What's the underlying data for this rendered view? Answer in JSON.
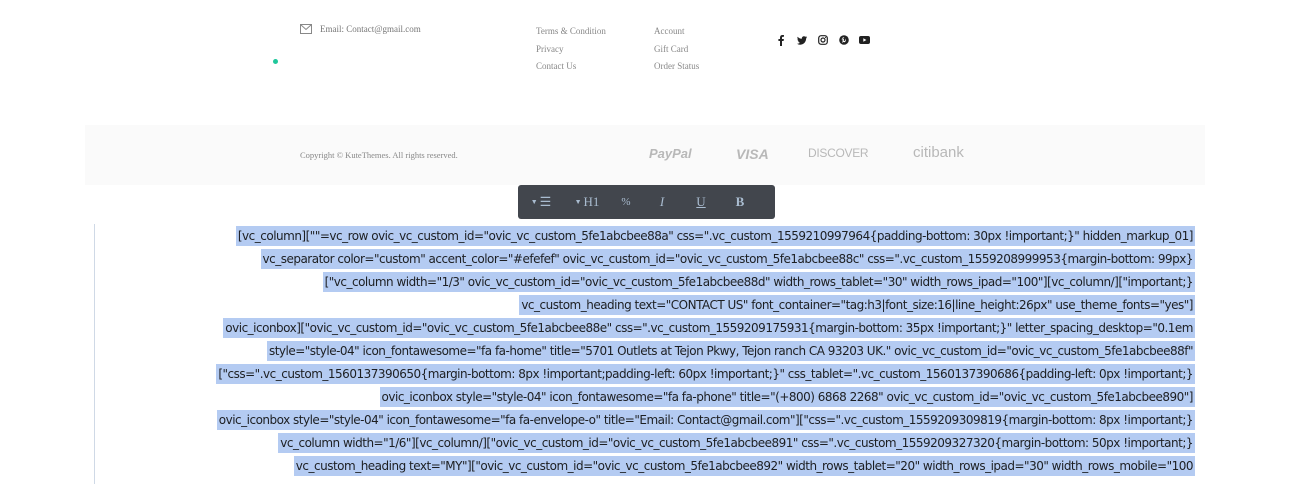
{
  "footer": {
    "email_text": "Email: Contact@gmail.com",
    "links_col1": [
      "Terms & Condition",
      "Privacy",
      "Contact Us"
    ],
    "links_col2": [
      "Account",
      "Gift Card",
      "Order Status"
    ],
    "social_icons": [
      "facebook-icon",
      "twitter-icon",
      "instagram-icon",
      "pinterest-icon",
      "youtube-icon"
    ],
    "accent_color": "#1fc79b"
  },
  "bottom_bar": {
    "copyright": "Copyright © KuteThemes. All rights reserved.",
    "payments": [
      "PayPal",
      "VISA",
      "DISCOVER",
      "citibank"
    ]
  },
  "toolbar": {
    "list_label": "☰",
    "heading_label": "H1",
    "link_label": "%",
    "italic_label": "I",
    "underline_label": "U",
    "bold_label": "B"
  },
  "editor": {
    "lines": [
      "[vc_column][\"\"=vc_row ovic_vc_custom_id=\"ovic_vc_custom_5fe1abcbee88a\" css=\".vc_custom_1559210997964{padding-bottom: 30px !important;}\" hidden_markup_01]",
      "vc_separator color=\"custom\" accent_color=\"#efefef\" ovic_vc_custom_id=\"ovic_vc_custom_5fe1abcbee88c\" css=\".vc_custom_1559208999953{margin-bottom: 99px}",
      "[\"vc_column width=\"1/3\" ovic_vc_custom_id=\"ovic_vc_custom_5fe1abcbee88d\" width_rows_tablet=\"30\" width_rows_ipad=\"100\"][vc_column/][\"important;}",
      "vc_custom_heading text=\"CONTACT US\" font_container=\"tag:h3|font_size:16|line_height:26px\" use_theme_fonts=\"yes\"]",
      "ovic_iconbox][\"ovic_vc_custom_id=\"ovic_vc_custom_5fe1abcbee88e\" css=\".vc_custom_1559209175931{margin-bottom: 35px !important;}\" letter_spacing_desktop=\"0.1em",
      "style=\"style-04\" icon_fontawesome=\"fa fa-home\" title=\"5701 Outlets at Tejon Pkwy, Tejon ranch CA 93203 UK.\" ovic_vc_custom_id=\"ovic_vc_custom_5fe1abcbee88f\"",
      "[\"css=\".vc_custom_1560137390650{margin-bottom: 8px !important;padding-left: 60px !important;}\" css_tablet=\".vc_custom_1560137390686{padding-left: 0px !important;}",
      "ovic_iconbox style=\"style-04\" icon_fontawesome=\"fa fa-phone\" title=\"(+800) 6868 2268\" ovic_vc_custom_id=\"ovic_vc_custom_5fe1abcbee890\"]",
      "ovic_iconbox style=\"style-04\" icon_fontawesome=\"fa fa-envelope-o\" title=\"Email: Contact@gmail.com\"][\"css=\".vc_custom_1559209309819{margin-bottom: 8px !important;}",
      "vc_column width=\"1/6\"][vc_column/][\"ovic_vc_custom_id=\"ovic_vc_custom_5fe1abcbee891\" css=\".vc_custom_1559209327320{margin-bottom: 50px !important;}",
      "vc_custom_heading text=\"MY\"][\"ovic_vc_custom_id=\"ovic_vc_custom_5fe1abcbee892\" width_rows_tablet=\"20\" width_rows_ipad=\"30\" width_rows_mobile=\"100"
    ]
  }
}
